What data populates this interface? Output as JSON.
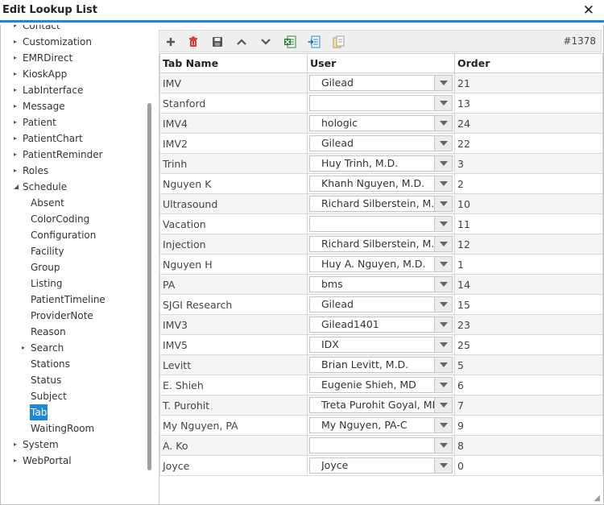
{
  "window": {
    "title": "Edit Lookup List",
    "close_glyph": "✕"
  },
  "tree": [
    {
      "label": "Contact",
      "arrow": "▸",
      "level": 0
    },
    {
      "label": "Customization",
      "arrow": "▸",
      "level": 0
    },
    {
      "label": "EMRDirect",
      "arrow": "▸",
      "level": 0
    },
    {
      "label": "KioskApp",
      "arrow": "▸",
      "level": 0
    },
    {
      "label": "LabInterface",
      "arrow": "▸",
      "level": 0
    },
    {
      "label": "Message",
      "arrow": "▸",
      "level": 0
    },
    {
      "label": "Patient",
      "arrow": "▸",
      "level": 0
    },
    {
      "label": "PatientChart",
      "arrow": "▸",
      "level": 0
    },
    {
      "label": "PatientReminder",
      "arrow": "▸",
      "level": 0
    },
    {
      "label": "Roles",
      "arrow": "▸",
      "level": 0
    },
    {
      "label": "Schedule",
      "arrow": "◢",
      "level": 0
    },
    {
      "label": "Absent",
      "arrow": "",
      "level": 1
    },
    {
      "label": "ColorCoding",
      "arrow": "",
      "level": 1
    },
    {
      "label": "Configuration",
      "arrow": "",
      "level": 1
    },
    {
      "label": "Facility",
      "arrow": "",
      "level": 1
    },
    {
      "label": "Group",
      "arrow": "",
      "level": 1
    },
    {
      "label": "Listing",
      "arrow": "",
      "level": 1
    },
    {
      "label": "PatientTimeline",
      "arrow": "",
      "level": 1
    },
    {
      "label": "ProviderNote",
      "arrow": "",
      "level": 1
    },
    {
      "label": "Reason",
      "arrow": "",
      "level": 1
    },
    {
      "label": "Search",
      "arrow": "▸",
      "level": 1
    },
    {
      "label": "Stations",
      "arrow": "",
      "level": 1
    },
    {
      "label": "Status",
      "arrow": "",
      "level": 1
    },
    {
      "label": "Subject",
      "arrow": "",
      "level": 1
    },
    {
      "label": "Tab",
      "arrow": "",
      "level": 1,
      "selected": true
    },
    {
      "label": "WaitingRoom",
      "arrow": "",
      "level": 1
    },
    {
      "label": "System",
      "arrow": "▸",
      "level": 0
    },
    {
      "label": "WebPortal",
      "arrow": "▸",
      "level": 0
    }
  ],
  "toolbar": {
    "buttons": [
      {
        "name": "add-icon",
        "color": "#555555"
      },
      {
        "name": "delete-icon",
        "color": "#e53935"
      },
      {
        "name": "save-icon",
        "color": "#555555"
      },
      {
        "name": "move-up-icon",
        "color": "#555555"
      },
      {
        "name": "move-down-icon",
        "color": "#555555"
      },
      {
        "name": "excel-export-icon",
        "color": "#2e7d32"
      },
      {
        "name": "import-icon",
        "color": "#1e88d8"
      },
      {
        "name": "copy-icon",
        "color": "#c49a3a"
      }
    ],
    "record_count": "#1378"
  },
  "grid": {
    "headers": {
      "tab_name": "Tab Name",
      "user": "User",
      "order": "Order"
    },
    "rows": [
      {
        "tab": "IMV",
        "user": "Gilead",
        "order": "21"
      },
      {
        "tab": "Stanford",
        "user": "",
        "order": "13"
      },
      {
        "tab": "IMV4",
        "user": "hologic",
        "order": "24"
      },
      {
        "tab": "IMV2",
        "user": "Gilead",
        "order": "22"
      },
      {
        "tab": "Trinh",
        "user": "Huy Trinh, M.D.",
        "order": "3"
      },
      {
        "tab": "Nguyen K",
        "user": "Khanh Nguyen, M.D.",
        "order": "2"
      },
      {
        "tab": "Ultrasound",
        "user": "Richard Silberstein, M.D.",
        "order": "10"
      },
      {
        "tab": "Vacation",
        "user": "",
        "order": "11"
      },
      {
        "tab": "Injection",
        "user": "Richard Silberstein, M.D.",
        "order": "12"
      },
      {
        "tab": "Nguyen H",
        "user": "Huy A. Nguyen, M.D.",
        "order": "1"
      },
      {
        "tab": "PA",
        "user": "bms",
        "order": "14"
      },
      {
        "tab": "SJGI Research",
        "user": "Gilead",
        "order": "15"
      },
      {
        "tab": "IMV3",
        "user": "Gilead1401",
        "order": "23"
      },
      {
        "tab": "IMV5",
        "user": "IDX",
        "order": "25"
      },
      {
        "tab": "Levitt",
        "user": "Brian Levitt, M.D.",
        "order": "5"
      },
      {
        "tab": "E. Shieh",
        "user": "Eugenie Shieh, MD",
        "order": "6"
      },
      {
        "tab": "T. Purohit",
        "user": "Treta Purohit Goyal, MD",
        "order": "7"
      },
      {
        "tab": "My Nguyen, PA",
        "user": "My Nguyen, PA-C",
        "order": "9"
      },
      {
        "tab": "A. Ko",
        "user": "",
        "order": "8"
      },
      {
        "tab": "Joyce",
        "user": "Joyce",
        "order": "0"
      }
    ]
  }
}
